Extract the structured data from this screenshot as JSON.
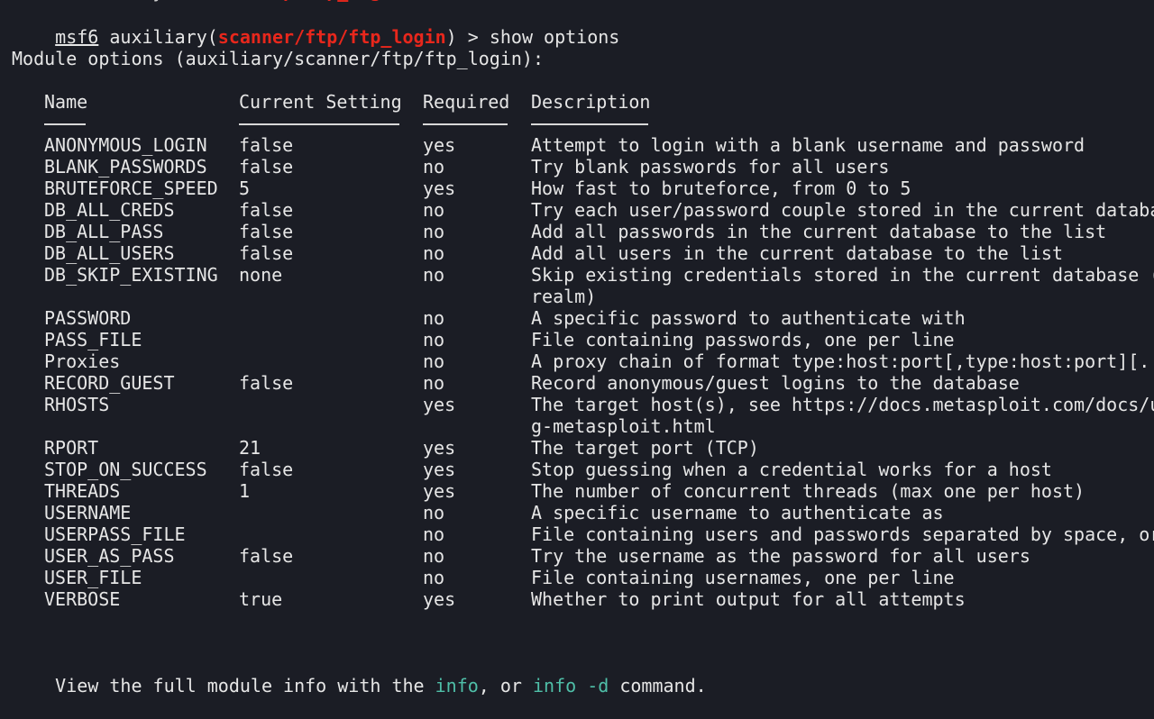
{
  "prompt": {
    "msf": "msf6",
    "pre": " auxiliary(",
    "module": "scanner/ftp/ftp_login",
    "post": ") > "
  },
  "top_command": "show options",
  "module_options_heading": "Module options (auxiliary/scanner/ftp/ftp_login):",
  "table": {
    "headers": {
      "name": "Name",
      "setting": "Current Setting",
      "required": "Required",
      "description": "Description"
    },
    "rows": [
      {
        "name": "ANONYMOUS_LOGIN",
        "setting": "false",
        "required": "yes",
        "description": "Attempt to login with a blank username and password"
      },
      {
        "name": "BLANK_PASSWORDS",
        "setting": "false",
        "required": "no",
        "description": "Try blank passwords for all users"
      },
      {
        "name": "BRUTEFORCE_SPEED",
        "setting": "5",
        "required": "yes",
        "description": "How fast to bruteforce, from 0 to 5"
      },
      {
        "name": "DB_ALL_CREDS",
        "setting": "false",
        "required": "no",
        "description": "Try each user/password couple stored in the current databa"
      },
      {
        "name": "DB_ALL_PASS",
        "setting": "false",
        "required": "no",
        "description": "Add all passwords in the current database to the list"
      },
      {
        "name": "DB_ALL_USERS",
        "setting": "false",
        "required": "no",
        "description": "Add all users in the current database to the list"
      },
      {
        "name": "DB_SKIP_EXISTING",
        "setting": "none",
        "required": "no",
        "description": "Skip existing credentials stored in the current database (",
        "description_cont": "realm)"
      },
      {
        "name": "PASSWORD",
        "setting": "",
        "required": "no",
        "description": "A specific password to authenticate with"
      },
      {
        "name": "PASS_FILE",
        "setting": "",
        "required": "no",
        "description": "File containing passwords, one per line"
      },
      {
        "name": "Proxies",
        "setting": "",
        "required": "no",
        "description": "A proxy chain of format type:host:port[,type:host:port][.."
      },
      {
        "name": "RECORD_GUEST",
        "setting": "false",
        "required": "no",
        "description": "Record anonymous/guest logins to the database"
      },
      {
        "name": "RHOSTS",
        "setting": "",
        "required": "yes",
        "description": "The target host(s), see https://docs.metasploit.com/docs/u",
        "description_cont": "g-metasploit.html"
      },
      {
        "name": "RPORT",
        "setting": "21",
        "required": "yes",
        "description": "The target port (TCP)"
      },
      {
        "name": "STOP_ON_SUCCESS",
        "setting": "false",
        "required": "yes",
        "description": "Stop guessing when a credential works for a host"
      },
      {
        "name": "THREADS",
        "setting": "1",
        "required": "yes",
        "description": "The number of concurrent threads (max one per host)"
      },
      {
        "name": "USERNAME",
        "setting": "",
        "required": "no",
        "description": "A specific username to authenticate as"
      },
      {
        "name": "USERPASS_FILE",
        "setting": "",
        "required": "no",
        "description": "File containing users and passwords separated by space, or"
      },
      {
        "name": "USER_AS_PASS",
        "setting": "false",
        "required": "no",
        "description": "Try the username as the password for all users"
      },
      {
        "name": "USER_FILE",
        "setting": "",
        "required": "no",
        "description": "File containing usernames, one per line"
      },
      {
        "name": "VERBOSE",
        "setting": "true",
        "required": "yes",
        "description": "Whether to print output for all attempts"
      }
    ]
  },
  "footer": {
    "pre": "View the full module info with the ",
    "info": "info",
    "mid": ", or ",
    "info_d": "info -d",
    "post": " command."
  },
  "colors": {
    "background": "#1b1d25",
    "text": "#e6e6e6",
    "module_red": "#e8271c",
    "command_teal": "#4fbfa8"
  }
}
